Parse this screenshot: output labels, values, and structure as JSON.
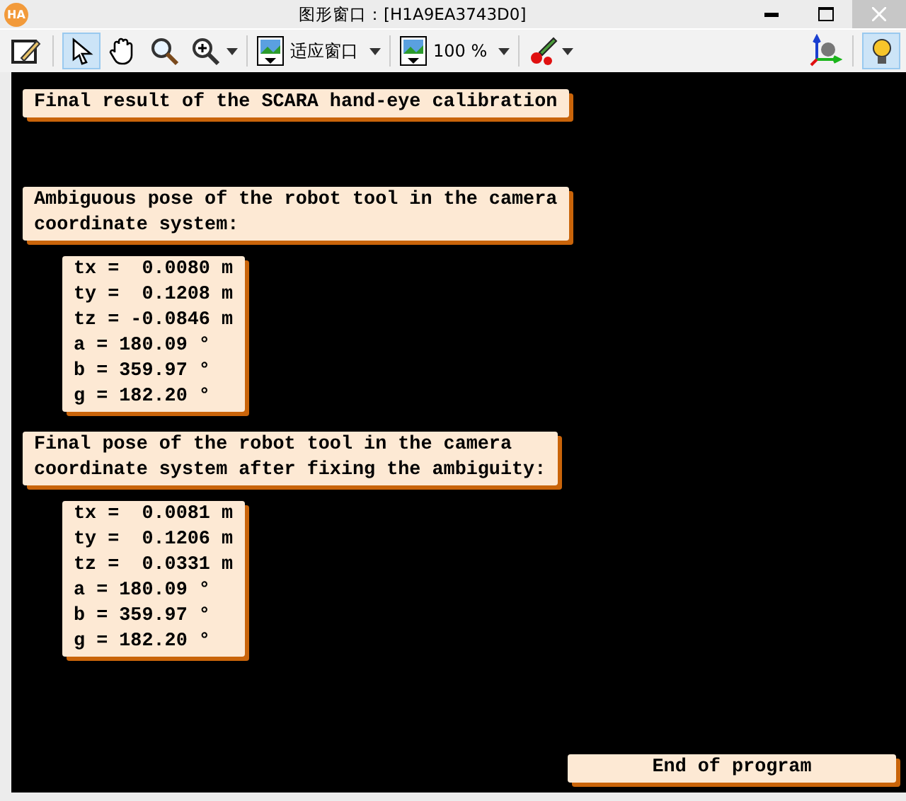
{
  "window": {
    "title": "图形窗口：[H1A9EA3743D0]",
    "app_badge": "HA"
  },
  "toolbar": {
    "left_tools": [
      {
        "kind": "edit",
        "selected": false
      },
      {
        "kind": "pointer",
        "selected": true
      },
      {
        "kind": "hand",
        "selected": false
      },
      {
        "kind": "magnifier",
        "selected": false
      },
      {
        "kind": "zoom",
        "selected": false,
        "dropdown": true
      }
    ],
    "fit_label": "适应窗口",
    "zoom_label": "100 %",
    "right_tools": [
      {
        "kind": "axes",
        "selected": false
      },
      {
        "kind": "bulb",
        "selected": true
      }
    ]
  },
  "messages": [
    {
      "kind": "message",
      "lines": [
        "Final result of the SCARA hand-eye calibration"
      ]
    },
    {
      "kind": "message",
      "lines": [
        "Ambiguous pose of the robot tool in the camera",
        "coordinate system:"
      ]
    },
    {
      "kind": "message",
      "lines": [
        "tx =  0.0080 m",
        "ty =  0.1208 m",
        "tz = -0.0846 m",
        "a = 180.09 °",
        "b = 359.97 °",
        "g = 182.20 °"
      ]
    },
    {
      "kind": "message",
      "lines": [
        "Final pose of the robot tool in the camera",
        "coordinate system after fixing the ambiguity:"
      ]
    },
    {
      "kind": "message",
      "lines": [
        "tx =  0.0081 m",
        "ty =  0.1206 m",
        "tz =  0.0331 m",
        "a = 180.09 °",
        "b = 359.97 °",
        "g = 182.20 °"
      ]
    },
    {
      "kind": "footer",
      "lines": [
        "End of program"
      ]
    }
  ]
}
